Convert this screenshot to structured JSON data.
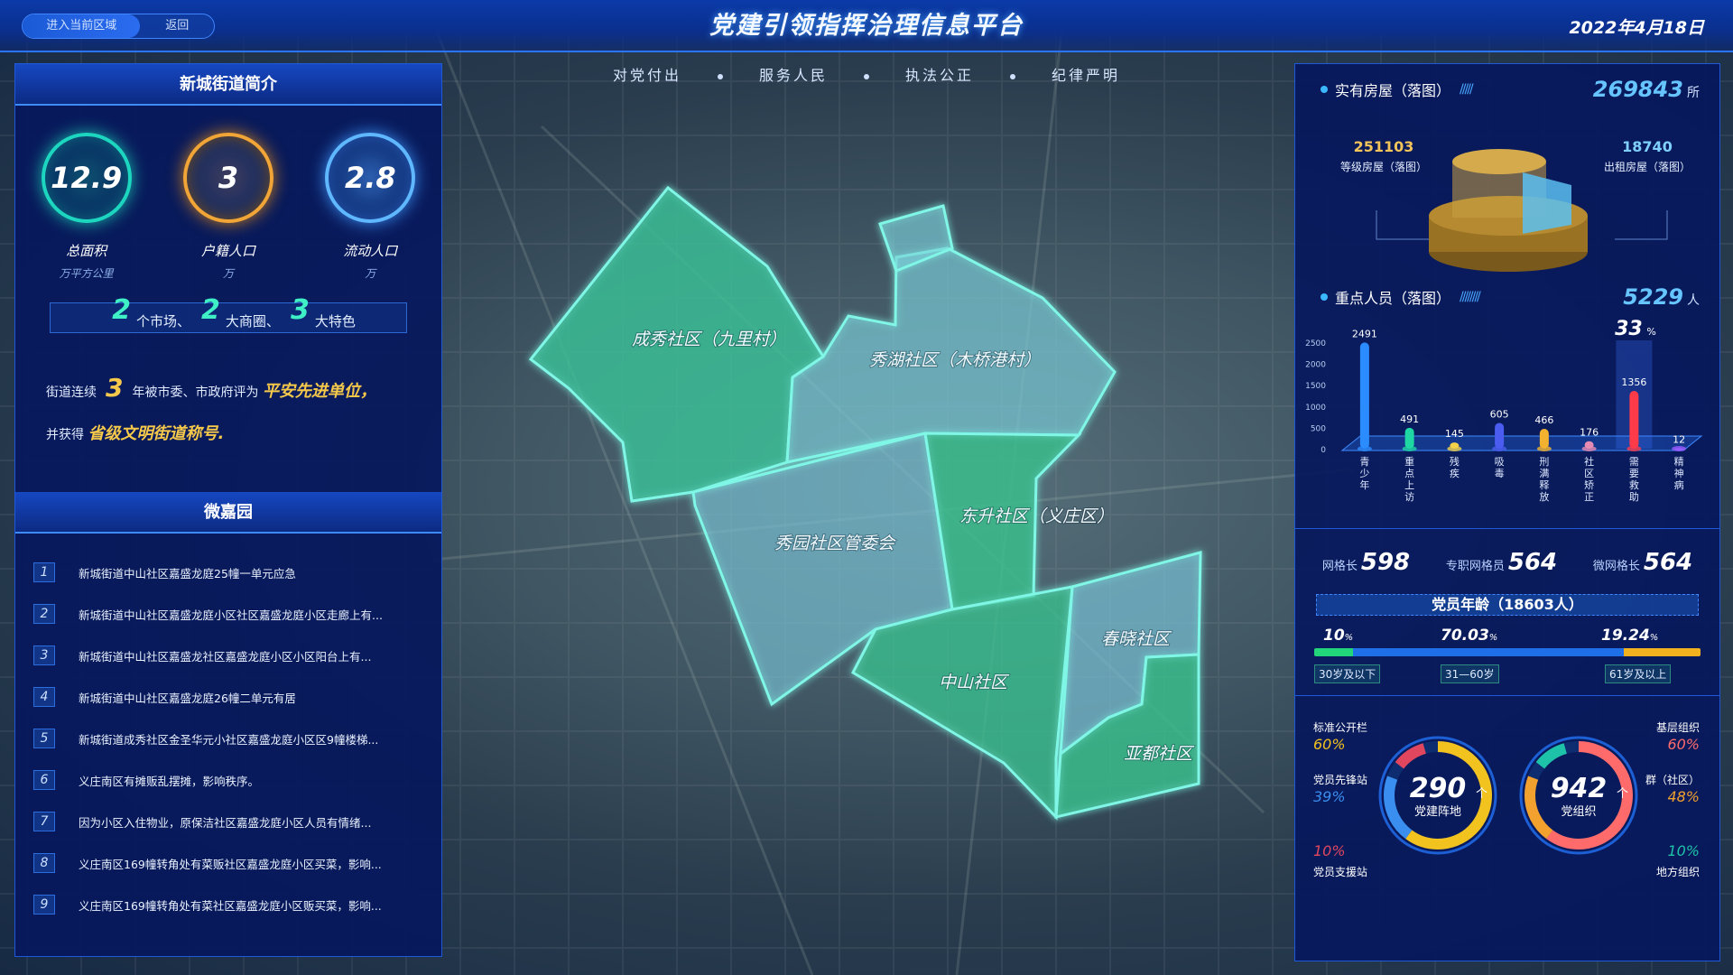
{
  "header": {
    "title": "党建引领指挥治理信息平台",
    "date": "2022年4月18日",
    "nav": [
      "进入当前区域",
      "返回"
    ],
    "slogans": [
      "对党付出",
      "服务人民",
      "执法公正",
      "纪律严明"
    ]
  },
  "map": {
    "districts": [
      "成秀社区（九里村）",
      "秀湖社区（木桥港村）",
      "秀园社区管委会",
      "东升社区（义庄区）",
      "中山社区",
      "春晓社区",
      "亚都社区"
    ]
  },
  "left": {
    "intro_title": "新城街道简介",
    "stats": [
      {
        "value": "12.9",
        "label": "总面积",
        "unit": "万平方公里"
      },
      {
        "value": "3",
        "label": "户籍人口",
        "unit": "万"
      },
      {
        "value": "2.8",
        "label": "流动人口",
        "unit": "万"
      }
    ],
    "markets": {
      "n1": "2",
      "t1": "个市场、",
      "n2": "2",
      "t2": "大商圈、",
      "n3": "3",
      "t3": "大特色"
    },
    "honor": {
      "p1": "街道连续",
      "num": "3",
      "p2": "年被市委、市政府评为",
      "hl1": "平安先进单位，",
      "p3": "并获得",
      "hl2": "省级文明街道称号."
    },
    "wjy_title": "微嘉园",
    "items": [
      {
        "idx": "1",
        "text": "新城街道中山社区嘉盛龙庭25幢一单元应急"
      },
      {
        "idx": "2",
        "text": "新城街道中山社区嘉盛龙庭小区社区嘉盛龙庭小区走廊上有..."
      },
      {
        "idx": "3",
        "text": "新城街道中山社区嘉盛龙社区嘉盛龙庭小区小区阳台上有..."
      },
      {
        "idx": "4",
        "text": "新城街道中山社区嘉盛龙庭26幢二单元有居"
      },
      {
        "idx": "5",
        "text": "新城街道成秀社区金圣华元小社区嘉盛龙庭小区区9幢楼梯..."
      },
      {
        "idx": "6",
        "text": "义庄南区有摊贩乱摆摊，影响秩序。"
      },
      {
        "idx": "7",
        "text": "因为小区入住物业，原保洁社区嘉盛龙庭小区人员有情绪..."
      },
      {
        "idx": "8",
        "text": "义庄南区169幢转角处有菜贩社区嘉盛龙庭小区买菜，影响..."
      },
      {
        "idx": "9",
        "text": "义庄南区169幢转角处有菜社区嘉盛龙庭小区贩买菜，影响..."
      }
    ]
  },
  "right": {
    "housing": {
      "label": "实有房屋（落图）",
      "value": "269843",
      "unit": "所",
      "left_value": "251103",
      "left_label": "等级房屋（落图）",
      "right_value": "18740",
      "right_label": "出租房屋（落图）"
    },
    "key_people": {
      "label": "重点人员（落图）",
      "value": "5229",
      "unit": "人",
      "highlight_pct": "33",
      "pct_unit": "%"
    },
    "grid": {
      "g1_label": "网格长",
      "g1_value": "598",
      "g2_label": "专职网格员",
      "g2_value": "564",
      "g3_label": "微网格长",
      "g3_value": "564"
    },
    "age": {
      "title": "党员年龄（18603人）",
      "segments": [
        {
          "pct": "10",
          "label": "30岁及以下",
          "color": "#22d47a"
        },
        {
          "pct": "70.03",
          "label": "31—60岁",
          "color": "#1e6fe8"
        },
        {
          "pct": "19.24",
          "label": "61岁及以上",
          "color": "#f2b11e"
        }
      ],
      "pct_sign": "%"
    },
    "ring1": {
      "value": "290",
      "unit": "个",
      "label": "党建阵地",
      "items": [
        {
          "label": "标准公开栏",
          "pct": "60%",
          "color": "#f2c21e"
        },
        {
          "label": "党员先锋站",
          "pct": "39%",
          "color": "#3a8ef0"
        },
        {
          "label": "党员支援站",
          "pct": "10%",
          "color": "#e0475f"
        }
      ]
    },
    "ring2": {
      "value": "942",
      "unit": "个",
      "label": "党组织",
      "items": [
        {
          "label": "基层组织",
          "pct": "60%",
          "color": "#ff6b6b"
        },
        {
          "label": "群（社区）",
          "pct": "48%",
          "color": "#f2a12e"
        },
        {
          "label": "地方组织",
          "pct": "10%",
          "color": "#1ec2a8"
        }
      ]
    }
  },
  "chart_data": {
    "type": "bar",
    "categories": [
      "青少年",
      "重点上访",
      "残疾",
      "吸毒",
      "刑满释放",
      "社区矫正",
      "需要救助",
      "精神病"
    ],
    "values": [
      2491,
      491,
      145,
      605,
      466,
      176,
      1356,
      12
    ],
    "ylim": [
      0,
      2500
    ],
    "yticks": [
      "0",
      "500",
      "1000",
      "1500",
      "2000",
      "2500"
    ],
    "colors": [
      "#2a8cff",
      "#1ed7a2",
      "#f2d24a",
      "#4b5cf0",
      "#f2b12e",
      "#e88bb3",
      "#ff3b4a",
      "#9a5cff"
    ],
    "highlight_index": 6
  }
}
